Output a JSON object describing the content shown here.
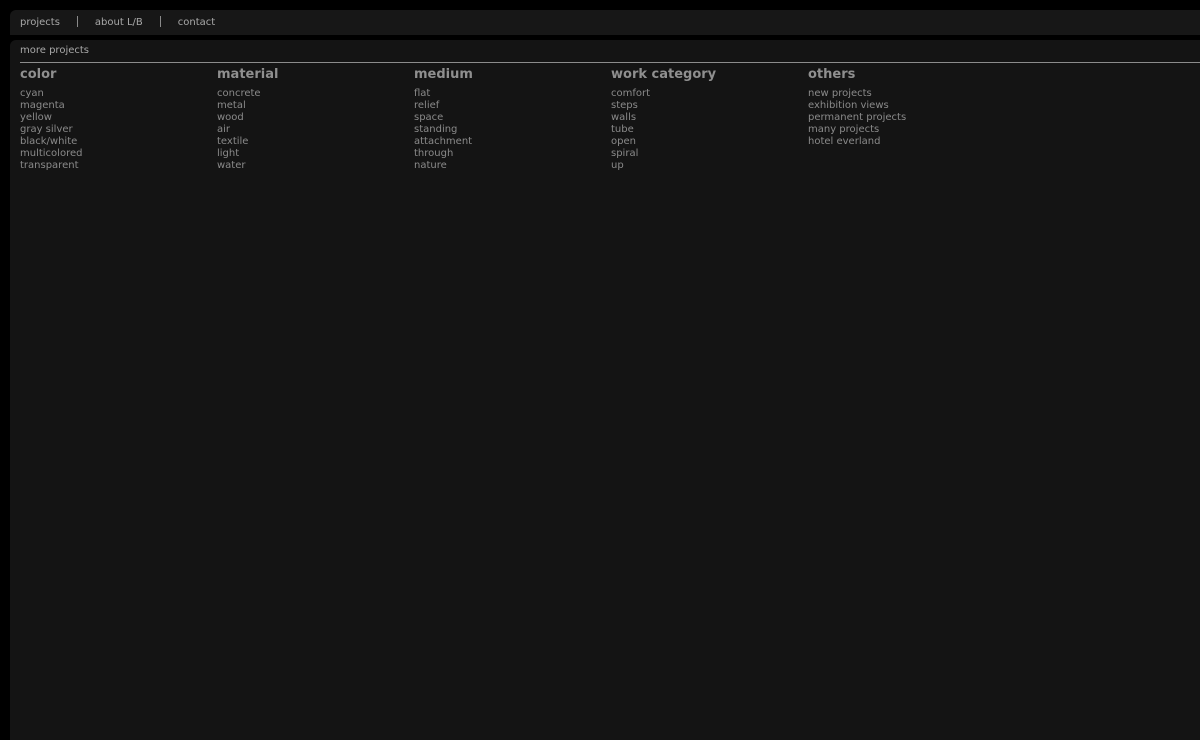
{
  "nav": {
    "items": [
      {
        "label": "projects"
      },
      {
        "label": "about L/B"
      },
      {
        "label": "contact"
      }
    ]
  },
  "main": {
    "section_title": "more projects",
    "columns": [
      {
        "title": "color",
        "items": [
          "cyan",
          "magenta",
          "yellow",
          "gray silver",
          "black/white",
          "multicolored",
          "transparent"
        ]
      },
      {
        "title": "material",
        "items": [
          "concrete",
          "metal",
          "wood",
          "air",
          "textile",
          "light",
          "water"
        ]
      },
      {
        "title": "medium",
        "items": [
          "flat",
          "relief",
          "space",
          "standing",
          "attachment",
          "through",
          "nature"
        ]
      },
      {
        "title": "work category",
        "items": [
          "comfort",
          "steps",
          "walls",
          "tube",
          "open",
          "spiral",
          "up"
        ]
      },
      {
        "title": "others",
        "items": [
          "new projects",
          "exhibition views",
          "permanent projects",
          "many projects",
          "hotel everland"
        ]
      }
    ]
  },
  "colors": {
    "page_background": "#000000",
    "panel_background": "#141414",
    "text": "#8a8a8a"
  }
}
